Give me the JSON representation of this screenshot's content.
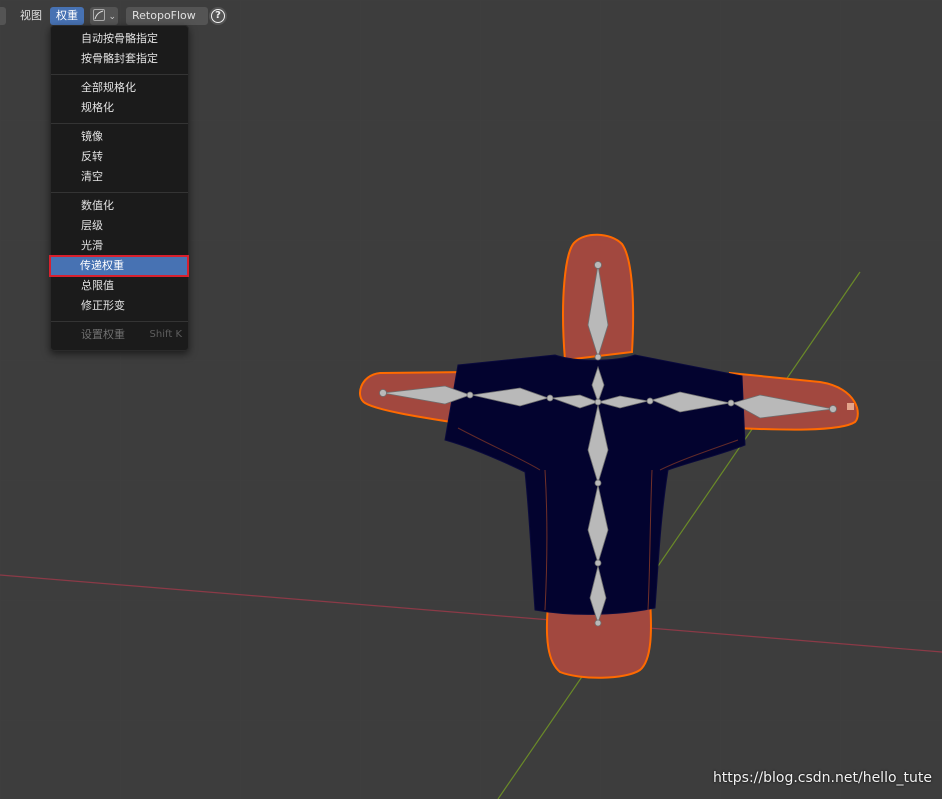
{
  "header": {
    "view_label": "视图",
    "weights_label": "权重",
    "addon_label": "RetopoFlow",
    "help_glyph": "?",
    "dropdown_glyph": "⌄"
  },
  "weights_menu": {
    "items": [
      {
        "label": "自动按骨骼指定"
      },
      {
        "label": "按骨骼封套指定"
      },
      {
        "label": "全部规格化"
      },
      {
        "label": "规格化"
      },
      {
        "label": "镜像"
      },
      {
        "label": "反转"
      },
      {
        "label": "清空"
      },
      {
        "label": "数值化"
      },
      {
        "label": "层级"
      },
      {
        "label": "光滑"
      },
      {
        "label": "传递权重",
        "state": "highlighted"
      },
      {
        "label": "总限值"
      },
      {
        "label": "修正形变"
      },
      {
        "label": "设置权重",
        "shortcut": "Shift K",
        "state": "disabled"
      }
    ]
  },
  "watermark": "https://blog.csdn.net/hello_tute",
  "colors": {
    "viewport_bg": "#3d3d3d",
    "menu_bg": "#1b1b1b",
    "highlight": "#4772b3",
    "highlight_outline": "#d8202e",
    "mesh_weight": "#a2483f",
    "mesh_outline": "#ff6a00",
    "shirt": "#020230",
    "bone": "#b9b9b9",
    "axis_x": "#8b3a47",
    "axis_y": "#6a8a28"
  }
}
